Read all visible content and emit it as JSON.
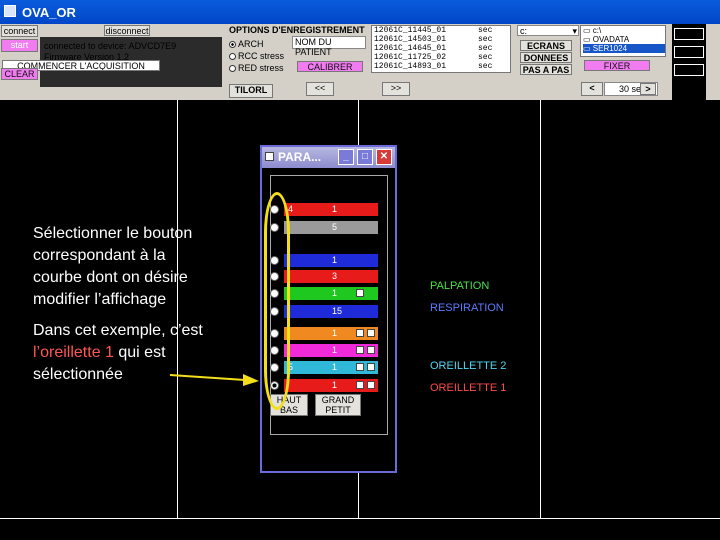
{
  "window": {
    "title": "OVA_OR"
  },
  "toolbar": {
    "connect_label": "connect",
    "start_label": "start",
    "disconnect_label": "disconnect",
    "status_lines": [
      "connected to device: ADVCD7E9",
      "Firmware Version  1.2"
    ],
    "commencer_label": "COMMENCER L'ACQUISITION",
    "clear_label": "CLEAR",
    "options_title": "OPTIONS D'ENREGISTREMENT",
    "radio_options": [
      "ARCH",
      "RCC stress",
      "RED stress"
    ],
    "patient_field": "NOM DU PATIENT",
    "calibrer_label": "CALIBRER",
    "tilt_label": "TILORL",
    "prev_label": "<<",
    "next_label": ">>",
    "file_list": [
      "12061C_11445_01",
      "12061C_14503_01",
      "12061C_14645_01",
      "12061C_11725_02",
      "12061C_14893_01"
    ],
    "file_suffix": "sec",
    "drive_value": "c:",
    "ecrans_label": "ECRANS",
    "donnees_label": "DONNEES",
    "pas_label": "PAS A PAS",
    "folder_items": [
      "c:\\",
      "OVADATA",
      "SER1024"
    ],
    "fixer_label": "FIXER",
    "page_prev": "<",
    "page_next": ">",
    "page_value": "30 sec"
  },
  "para_window": {
    "title": "PARA...",
    "rows": [
      {
        "num": "4",
        "val": "1",
        "color": "#e81b1b"
      },
      {
        "num": "",
        "val": "5",
        "color": "#9a9a9a"
      },
      {
        "num": "",
        "val": "1",
        "color": "#1f2bd8"
      },
      {
        "num": "",
        "val": "3",
        "color": "#e81b1b"
      },
      {
        "num": "",
        "val": "1",
        "color": "#1ec81e"
      },
      {
        "num": "",
        "val": "15",
        "color": "#1f2bd8"
      },
      {
        "num": "",
        "val": "1",
        "color": "#f08a20"
      },
      {
        "num": "",
        "val": "1",
        "color": "#f02ad8"
      },
      {
        "num": "5",
        "val": "1",
        "color": "#30b8d8"
      },
      {
        "num": "",
        "val": "1",
        "color": "#e81b1b"
      }
    ],
    "btn_haut_bas": [
      "HAUT",
      "BAS"
    ],
    "btn_grand_petit": [
      "GRAND",
      "PETIT"
    ]
  },
  "annotation": {
    "line1": "Sélectionner le bouton",
    "line2": "correspondant à la",
    "line3": "courbe dont on désire",
    "line4": "modifier l’affichage",
    "line5": "Dans cet exemple, c’est",
    "line6_hl": "l’oreillette 1",
    "line6_rest": " qui est",
    "line7": "sélectionnée"
  },
  "series_labels": [
    {
      "text": "PALPATION",
      "color": "#4be04b"
    },
    {
      "text": "RESPIRATION",
      "color": "#5b7cff"
    },
    {
      "text": "OREILLETTE 2",
      "color": "#4ed8f0"
    },
    {
      "text": "OREILLETTE 1",
      "color": "#ff4a4a"
    }
  ],
  "colors": {
    "highlight_ring": "#f2df1a",
    "arrow": "#f2df1a"
  }
}
